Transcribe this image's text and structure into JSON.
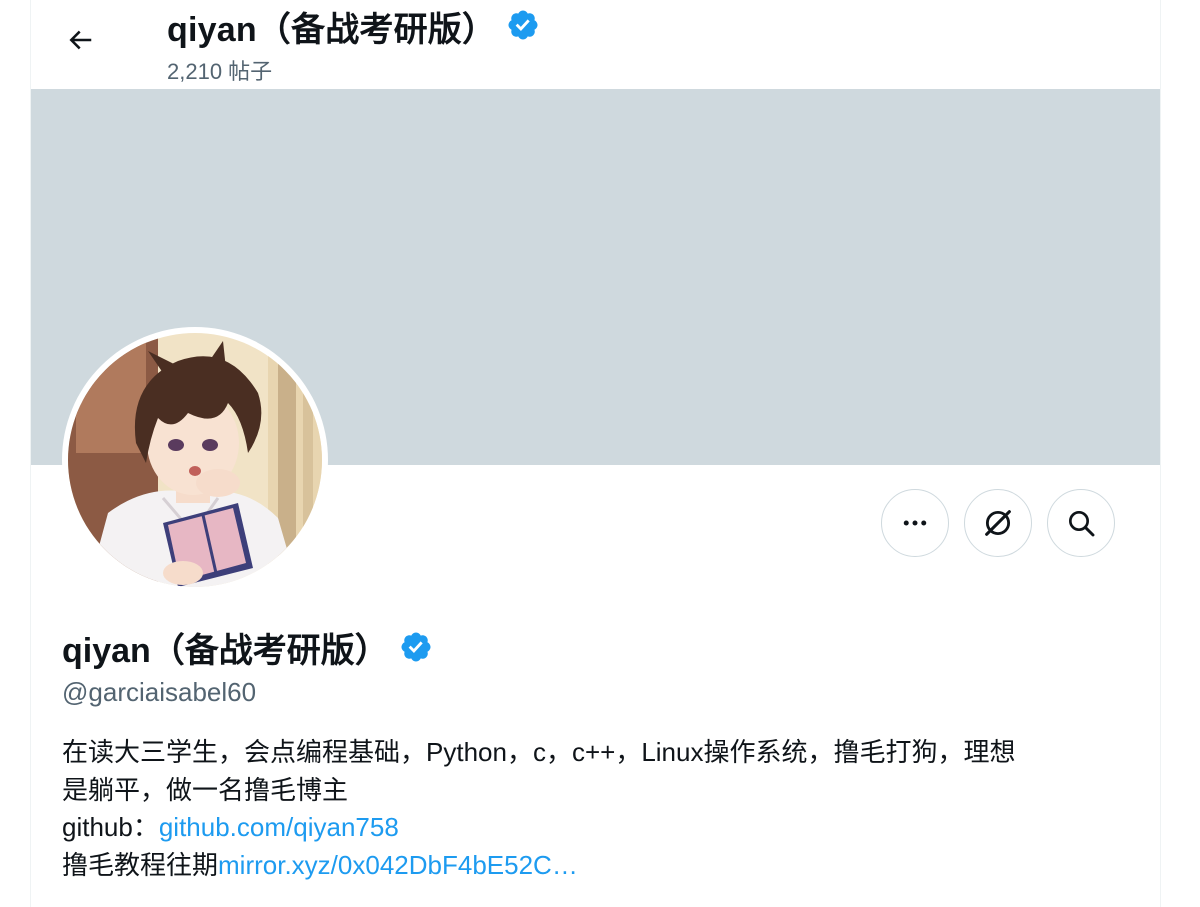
{
  "header": {
    "title": "qiyan（备战考研版）",
    "post_count": "2,210 帖子"
  },
  "profile": {
    "display_name": "qiyan（备战考研版）",
    "handle": "@garciaisabel60",
    "bio_line1": "在读大三学生，会点编程基础，Python，c，c++，Linux操作系统，撸毛打狗，理想",
    "bio_line2": "是躺平，做一名撸毛博主",
    "github_label": "github：",
    "github_link": "github.com/qiyan758",
    "tutorial_label": "撸毛教程往期",
    "tutorial_link": "mirror.xyz/0x042DbF4bE52C…"
  },
  "icons": {
    "back": "arrow-left-icon",
    "verified": "verified-badge-icon",
    "more": "more-icon",
    "grok": "grok-icon",
    "search": "search-icon"
  },
  "colors": {
    "accent": "#1d9bf0",
    "banner": "#cfd9de",
    "secondary_text": "#536471"
  }
}
